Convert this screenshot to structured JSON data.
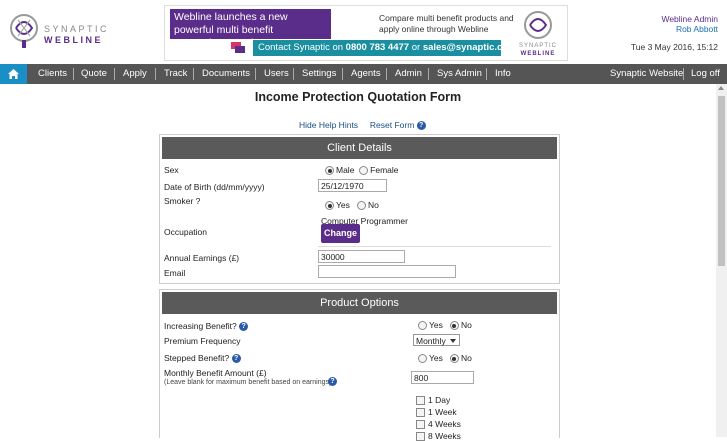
{
  "logo": {
    "line1": "SYNAPTIC",
    "line2": "WEBLINE"
  },
  "banner": {
    "headline": "Webline launches a new powerful multi benefit comparison service",
    "tagline": "Compare multi benefit products and apply online through Webline",
    "contact_prefix": "Contact Synaptic on ",
    "contact_phone": "0800 783 4477",
    "contact_mid": " or ",
    "contact_email": "sales@synaptic.co.uk",
    "logo_line1": "SYNAPTIC",
    "logo_line2": "WEBLINE"
  },
  "user": {
    "role": "Webline Admin",
    "name": "Rob Abbott",
    "date": "Tue 3 May 2016, 15:12"
  },
  "nav": {
    "items": [
      "Clients",
      "Quote",
      "Apply",
      "Track",
      "Documents",
      "Users",
      "Settings",
      "Agents",
      "Admin",
      "Sys Admin",
      "Info"
    ],
    "right_items": [
      "Synaptic Website",
      "Log off"
    ]
  },
  "page": {
    "title": "Income Protection Quotation Form",
    "hide_help": "Hide Help Hints",
    "reset_form": "Reset Form"
  },
  "client": {
    "heading": "Client Details",
    "sex_label": "Sex",
    "sex_male": "Male",
    "sex_female": "Female",
    "dob_label": "Date of Birth (dd/mm/yyyy)",
    "dob_value": "25/12/1970",
    "smoker_label": "Smoker ?",
    "smoker_yes": "Yes",
    "smoker_no": "No",
    "occupation_label": "Occupation",
    "occupation_value": "Computer Programmer",
    "change_label": "Change",
    "earnings_label": "Annual Earnings (£)",
    "earnings_value": "30000",
    "email_label": "Email",
    "email_value": ""
  },
  "product": {
    "heading": "Product Options",
    "increasing_label": "Increasing Benefit?",
    "increasing_yes": "Yes",
    "increasing_no": "No",
    "frequency_label": "Premium Frequency",
    "frequency_value": "Monthly",
    "stepped_label": "Stepped Benefit?",
    "stepped_yes": "Yes",
    "stepped_no": "No",
    "benefit_label": "Monthly Benefit Amount (£)",
    "benefit_hint": "(Leave blank for maximum benefit based on earnings)",
    "benefit_value": "800",
    "deferral_options": [
      "1 Day",
      "1 Week",
      "4 Weeks",
      "8 Weeks"
    ]
  },
  "icons": {
    "home": "home-icon",
    "help": "help-icon"
  },
  "colors": {
    "brand_purple": "#5a2d8a",
    "nav_bg": "#555555",
    "home_blue": "#1a8fc5",
    "contact_teal": "#1a8fa0",
    "panel_head": "#5a5a5a"
  }
}
